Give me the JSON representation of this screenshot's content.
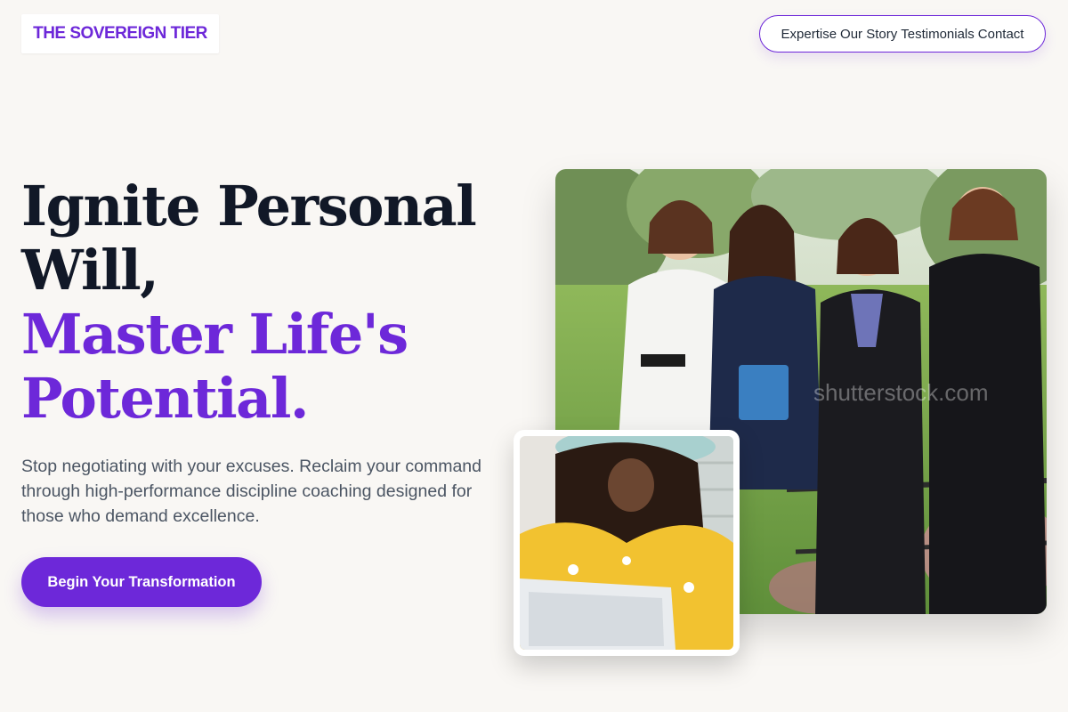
{
  "header": {
    "logo": "THE SOVEREIGN TIER",
    "nav": [
      "Expertise",
      "Our Story",
      "Testimonials",
      "Contact"
    ]
  },
  "hero": {
    "headline_line1": "Ignite Personal",
    "headline_line2": "Will,",
    "headline_line3": "Master Life's",
    "headline_line4": "Potential.",
    "subtext": "Stop negotiating with your excuses. Reclaim your command through high-performance discipline coaching designed for those who demand excellence.",
    "cta_label": "Begin Your Transformation"
  },
  "images": {
    "main_alt": "Four professional women in business attire standing outdoors",
    "secondary_alt": "Woman in yellow jacket and cap working on a laptop",
    "main_watermark": "shutterstock.com"
  },
  "colors": {
    "accent": "#6d28d9",
    "headline_dark": "#111827",
    "background": "#f9f7f4",
    "body_text": "#4b5563"
  }
}
